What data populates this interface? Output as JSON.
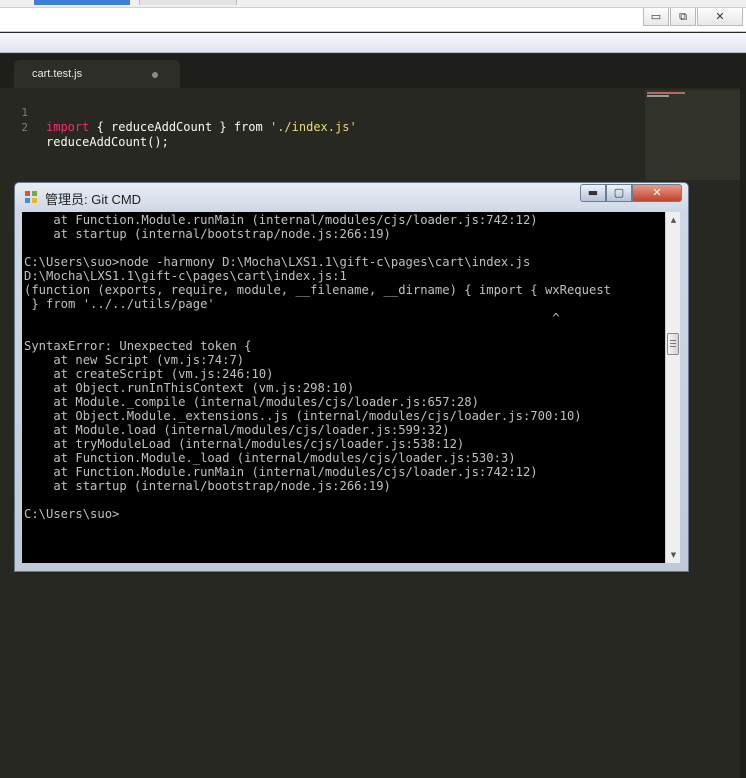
{
  "window": {
    "minimize_glyph": "▭",
    "maximize_glyph": "⧉",
    "close_glyph": "✕"
  },
  "editor": {
    "tab": {
      "filename": "cart.test.js"
    },
    "lines": [
      {
        "number": "1",
        "import_kw": "import",
        "middle": " { reduceAddCount } from ",
        "string": "'./index.js'"
      },
      {
        "number": "2",
        "text": "reduceAddCount();"
      }
    ],
    "colors": {
      "background": "#272822",
      "keyword": "#f92672",
      "string": "#e6db74",
      "text": "#f8f8f2"
    }
  },
  "cmd_window": {
    "title": "管理员: Git CMD",
    "minimize_glyph": "▬",
    "maximize_glyph": "▢",
    "close_glyph": "✕",
    "output": "    at Function.Module.runMain (internal/modules/cjs/loader.js:742:12)\n    at startup (internal/bootstrap/node.js:266:19)\n\nC:\\Users\\suo>node -harmony D:\\Mocha\\LXS1.1\\gift-c\\pages\\cart\\index.js\nD:\\Mocha\\LXS1.1\\gift-c\\pages\\cart\\index.js:1\n(function (exports, require, module, __filename, __dirname) { import { wxRequest\n } from '../../utils/page'\n                                                                        ^\n\nSyntaxError: Unexpected token {\n    at new Script (vm.js:74:7)\n    at createScript (vm.js:246:10)\n    at Object.runInThisContext (vm.js:298:10)\n    at Module._compile (internal/modules/cjs/loader.js:657:28)\n    at Object.Module._extensions..js (internal/modules/cjs/loader.js:700:10)\n    at Module.load (internal/modules/cjs/loader.js:599:32)\n    at tryModuleLoad (internal/modules/cjs/loader.js:538:12)\n    at Function.Module._load (internal/modules/cjs/loader.js:530:3)\n    at Function.Module.runMain (internal/modules/cjs/loader.js:742:12)\n    at startup (internal/bootstrap/node.js:266:19)\n\nC:\\Users\\suo>",
    "scroll_up_glyph": "▲",
    "scroll_down_glyph": "▼"
  }
}
